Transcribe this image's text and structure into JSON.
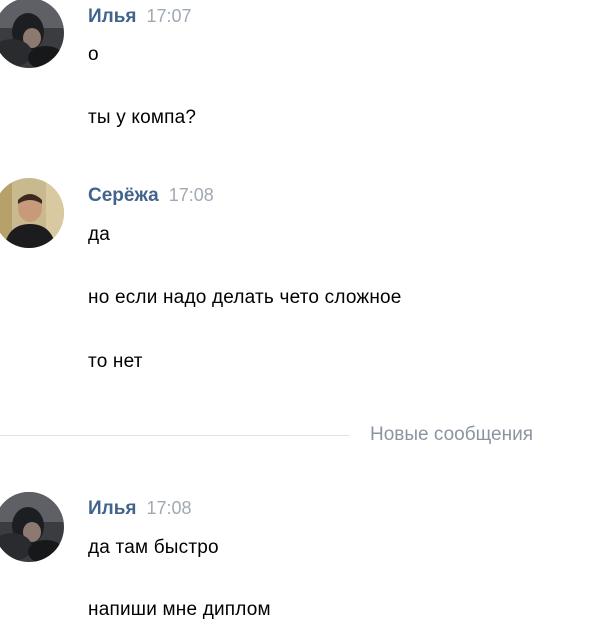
{
  "messages": [
    {
      "author": "Илья",
      "time": "17:07",
      "avatar_icon": "user-photo-ilya",
      "lines": [
        "о",
        "ты у компа?"
      ]
    },
    {
      "author": "Серёжа",
      "time": "17:08",
      "avatar_icon": "user-photo-seryozha",
      "lines": [
        "да",
        "но если надо делать чето сложное",
        "то нет"
      ]
    },
    {
      "author": "Илья",
      "time": "17:08",
      "avatar_icon": "user-photo-ilya",
      "lines": [
        "да там быстро",
        "напиши мне диплом"
      ]
    }
  ],
  "new_messages_divider": {
    "label": "Новые сообщения"
  },
  "colors": {
    "author_name": "#42648b",
    "time": "#a1a9b3",
    "divider_text": "#8b95a1",
    "divider_line": "#dfe3e8"
  }
}
